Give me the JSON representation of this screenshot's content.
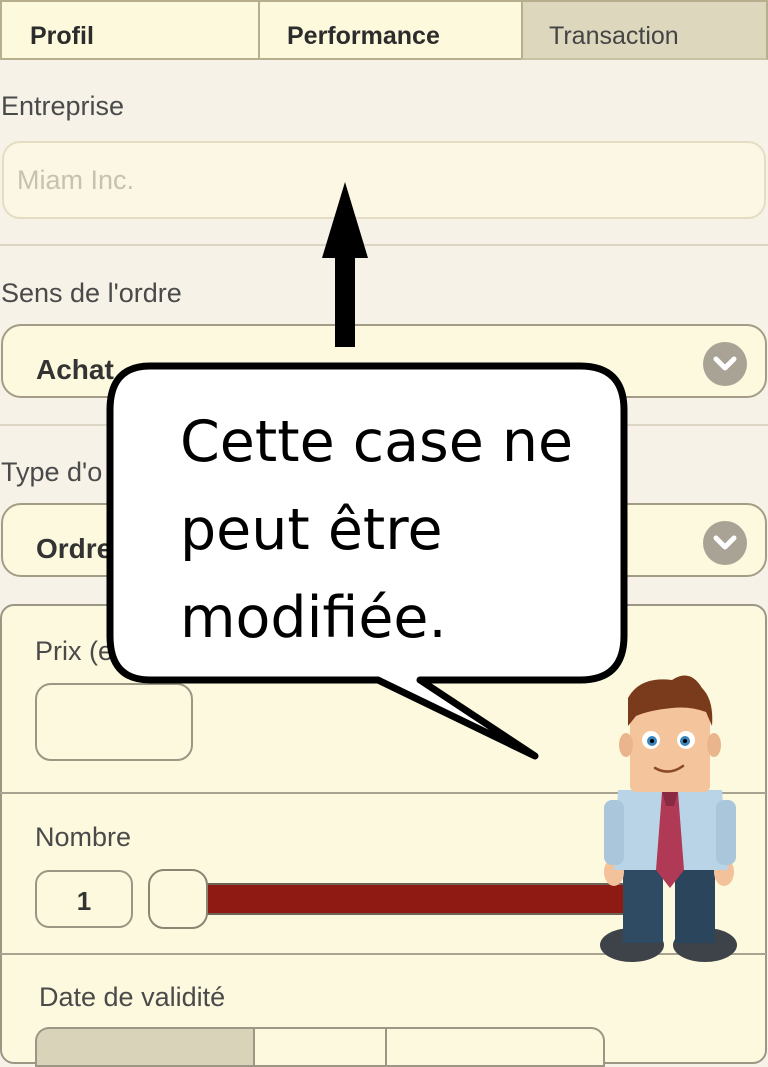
{
  "tabs": [
    {
      "label": "Profil"
    },
    {
      "label": "Performance"
    },
    {
      "label": "Transaction"
    }
  ],
  "company": {
    "label": "Entreprise",
    "placeholder": "Miam Inc."
  },
  "order_side": {
    "label": "Sens de l'ordre",
    "value": "Achat"
  },
  "order_type": {
    "label": "Type d'o",
    "value": "Ordre"
  },
  "price": {
    "label": "Prix (e"
  },
  "quantity": {
    "label": "Nombre",
    "value": "1"
  },
  "validity": {
    "label": "Date de validité"
  },
  "callout": {
    "text": "Cette case ne peut être modifiée."
  },
  "colors": {
    "slider_fill": "#8f1a13",
    "active_tab": "#ddd7bd",
    "panel": "#fdf9de"
  }
}
